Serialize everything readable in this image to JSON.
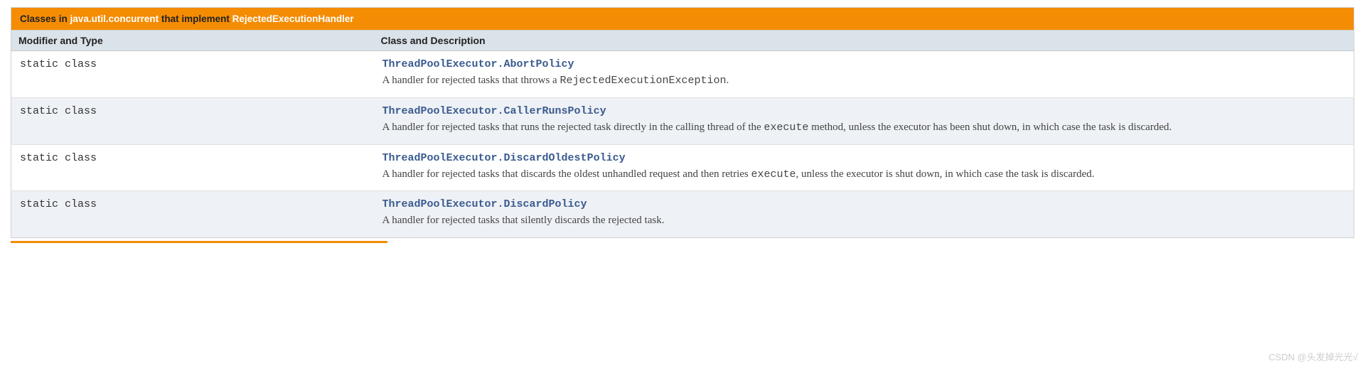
{
  "caption": {
    "prefix": "Classes in ",
    "package_link": "java.util.concurrent",
    "mid": " that implement ",
    "interface_link": "RejectedExecutionHandler"
  },
  "headers": {
    "col1": "Modifier and Type",
    "col2": "Class and Description"
  },
  "rows": [
    {
      "modifier": "static class ",
      "class_name": "ThreadPoolExecutor.AbortPolicy",
      "desc_parts": [
        {
          "t": "text",
          "v": "A handler for rejected tasks that throws a "
        },
        {
          "t": "code",
          "v": "RejectedExecutionException"
        },
        {
          "t": "text",
          "v": "."
        }
      ]
    },
    {
      "modifier": "static class ",
      "class_name": "ThreadPoolExecutor.CallerRunsPolicy",
      "desc_parts": [
        {
          "t": "text",
          "v": "A handler for rejected tasks that runs the rejected task directly in the calling thread of the "
        },
        {
          "t": "code",
          "v": "execute"
        },
        {
          "t": "text",
          "v": " method, unless the executor has been shut down, in which case the task is discarded."
        }
      ]
    },
    {
      "modifier": "static class ",
      "class_name": "ThreadPoolExecutor.DiscardOldestPolicy",
      "desc_parts": [
        {
          "t": "text",
          "v": "A handler for rejected tasks that discards the oldest unhandled request and then retries "
        },
        {
          "t": "code",
          "v": "execute"
        },
        {
          "t": "text",
          "v": ", unless the executor is shut down, in which case the task is discarded."
        }
      ]
    },
    {
      "modifier": "static class ",
      "class_name": "ThreadPoolExecutor.DiscardPolicy",
      "desc_parts": [
        {
          "t": "text",
          "v": "A handler for rejected tasks that silently discards the rejected task."
        }
      ]
    }
  ],
  "watermark": "CSDN @头发掉光光√"
}
